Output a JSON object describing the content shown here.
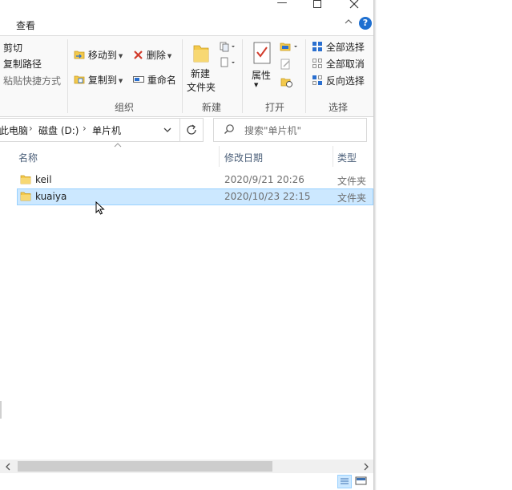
{
  "ribbon": {
    "tab_view": "查看",
    "groups": {
      "clipboard": {
        "cut": "剪切",
        "copy_path": "复制路径",
        "paste_shortcut": "粘贴快捷方式"
      },
      "organize": {
        "label": "组织",
        "move_to": "移动到",
        "copy_to": "复制到",
        "delete": "删除",
        "rename": "重命名"
      },
      "new": {
        "label": "新建",
        "new_folder_line1": "新建",
        "new_folder_line2": "文件夹"
      },
      "open": {
        "label": "打开",
        "properties": "属性"
      },
      "select": {
        "label": "选择",
        "select_all": "全部选择",
        "select_none": "全部取消",
        "invert": "反向选择"
      }
    }
  },
  "address": {
    "segments": [
      "此电脑",
      "磁盘 (D:)",
      "单片机"
    ]
  },
  "search": {
    "placeholder": "搜索\"单片机\""
  },
  "columns": {
    "name": "名称",
    "modified": "修改日期",
    "type": "类型"
  },
  "files": [
    {
      "name": "keil",
      "modified": "2020/9/21 20:26",
      "type": "文件夹",
      "selected": false
    },
    {
      "name": "kuaiya",
      "modified": "2020/10/23 22:15",
      "type": "文件夹",
      "selected": true
    }
  ],
  "colors": {
    "folder": "#f3c94c",
    "selection_bg": "#cce8ff",
    "selection_border": "#99d1ff",
    "help": "#1e6fd0",
    "column_header": "#4c607a"
  },
  "icons": [
    "minimize-icon",
    "maximize-icon",
    "close-icon",
    "help-icon",
    "folder-icon",
    "search-icon",
    "refresh-icon",
    "chevron-down-icon"
  ]
}
